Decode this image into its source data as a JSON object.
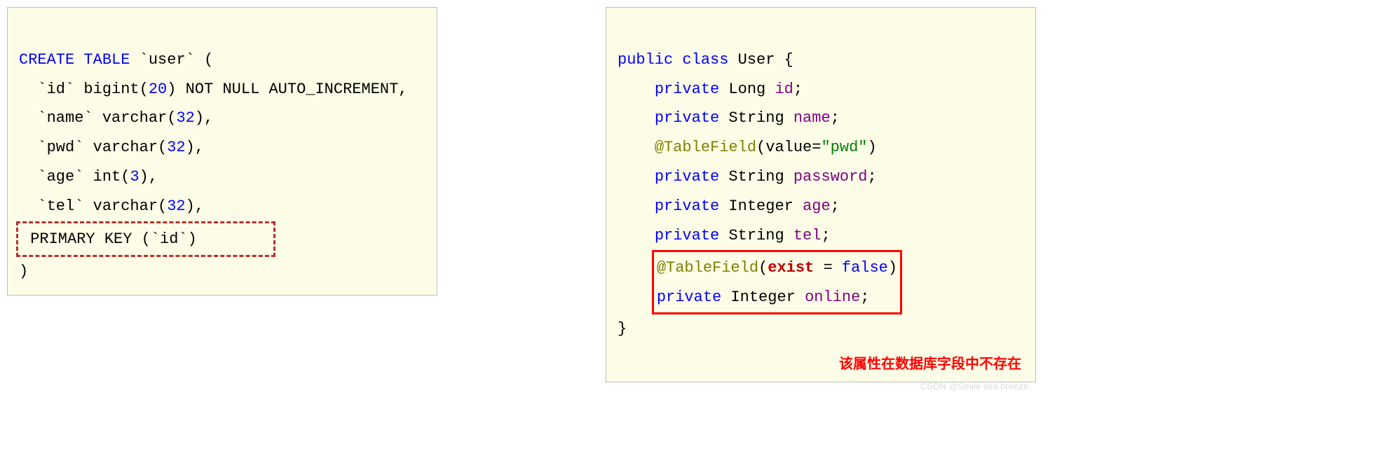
{
  "left": {
    "l1a": "CREATE TABLE",
    "l1b": " `user` (",
    "l2a": "  `id` bigint(",
    "l2b": "20",
    "l2c": ") NOT NULL AUTO_INCREMENT,",
    "l3a": "  `name` varchar(",
    "l3b": "32",
    "l3c": "),",
    "l4a": "  `pwd` varchar(",
    "l4b": "32",
    "l4c": "),",
    "l5a": "  `age` int(",
    "l5b": "3",
    "l5c": "),",
    "l6a": "  `tel` varchar(",
    "l6b": "32",
    "l6c": "),",
    "l7": " PRIMARY KEY (`id`)        ",
    "l8": ")"
  },
  "right": {
    "l1a": "public",
    "l1b": "class",
    "l1c": " User {",
    "l2a": "private",
    "l2b": " Long ",
    "l2c": "id",
    "l2d": ";",
    "l3a": "private",
    "l3b": " String ",
    "l3c": "name",
    "l3d": ";",
    "l4a": "@TableField",
    "l4b": "(value=",
    "l4c": "\"pwd\"",
    "l4d": ")",
    "l5a": "private",
    "l5b": " String ",
    "l5c": "password",
    "l5d": ";",
    "l6a": "private",
    "l6b": " Integer ",
    "l6c": "age",
    "l6d": ";",
    "l7a": "private",
    "l7b": " String ",
    "l7c": "tel",
    "l7d": ";",
    "l8a": "@TableField",
    "l8b": "(",
    "l8c": "exist",
    "l8d": " = ",
    "l8e": "false",
    "l8f": ")",
    "l9a": "private",
    "l9b": " Integer ",
    "l9c": "online",
    "l9d": ";",
    "l10": "}",
    "note": "该属性在数据库字段中不存在",
    "watermark": "CSDN @Smile sea breeze"
  }
}
